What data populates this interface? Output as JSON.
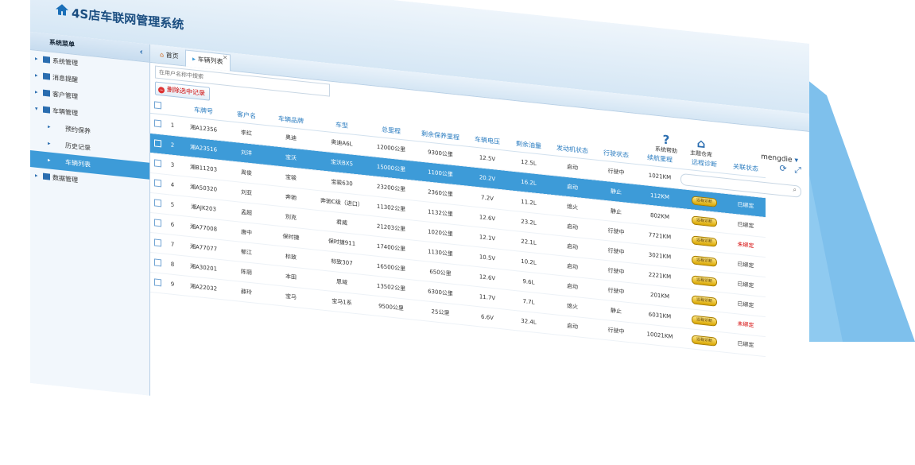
{
  "app": {
    "title": "4S店车联网管理系统"
  },
  "sidebar": {
    "header": "系统菜单",
    "collapse": "‹",
    "items": [
      {
        "label": "系统管理",
        "level": 0
      },
      {
        "label": "消息提醒",
        "level": 0
      },
      {
        "label": "客户管理",
        "level": 0
      },
      {
        "label": "车辆管理",
        "level": 0
      },
      {
        "label": "预约保养",
        "level": 1
      },
      {
        "label": "历史记录",
        "level": 1
      },
      {
        "label": "车辆列表",
        "level": 1
      },
      {
        "label": "数据管理",
        "level": 0
      }
    ]
  },
  "tabs": [
    {
      "label": "首页"
    },
    {
      "label": "车辆列表"
    }
  ],
  "toolbar": {
    "help_label": "系统帮助",
    "home_label": "主题仓库",
    "user": "mengdie",
    "search_placeholder": "在用户名称中搜索",
    "delete_label": "删除选中记录"
  },
  "table": {
    "columns": [
      "车牌号",
      "客户名",
      "车辆品牌",
      "车型",
      "总里程",
      "剩余保养里程",
      "车辆电压",
      "剩余油量",
      "发动机状态",
      "行驶状态",
      "续航里程",
      "远程诊断",
      "关联状态"
    ],
    "diag_label": "远程诊断",
    "selected_index": 1,
    "rows": [
      [
        "1",
        "湘A12356",
        "李红",
        "奥迪",
        "奥迪A6L",
        "12000公里",
        "9300公里",
        "12.5V",
        "12.5L",
        "启动",
        "行驶中",
        "1021KM",
        "已绑定"
      ],
      [
        "2",
        "湘A23516",
        "刘洋",
        "宝沃",
        "宝沃BX5",
        "15000公里",
        "1100公里",
        "20.2V",
        "16.2L",
        "启动",
        "静止",
        "112KM",
        "已绑定"
      ],
      [
        "3",
        "湘B11203",
        "周俊",
        "宝骏",
        "宝骏630",
        "23200公里",
        "2360公里",
        "7.2V",
        "11.2L",
        "熄火",
        "静止",
        "802KM",
        "已绑定"
      ],
      [
        "4",
        "湘A50320",
        "刘亚",
        "奔驰",
        "奔驰C级（进口）",
        "11302公里",
        "1132公里",
        "12.6V",
        "23.2L",
        "启动",
        "行驶中",
        "7721KM",
        "未绑定"
      ],
      [
        "5",
        "湘AJK203",
        "孟超",
        "別克",
        "君威",
        "21203公里",
        "1020公里",
        "12.1V",
        "22.1L",
        "启动",
        "行驶中",
        "3021KM",
        "已绑定"
      ],
      [
        "6",
        "湘A77008",
        "唐中",
        "保时捷",
        "保时捷911",
        "17400公里",
        "1130公里",
        "10.5V",
        "10.2L",
        "启动",
        "行驶中",
        "2221KM",
        "已绑定"
      ],
      [
        "7",
        "湘A77077",
        "郁江",
        "标致",
        "标致307",
        "16500公里",
        "650公里",
        "12.6V",
        "9.6L",
        "启动",
        "行驶中",
        "201KM",
        "已绑定"
      ],
      [
        "8",
        "湘A30201",
        "陈丽",
        "本田",
        "思域",
        "13502公里",
        "6300公里",
        "11.7V",
        "7.7L",
        "熄火",
        "静止",
        "6031KM",
        "未绑定"
      ],
      [
        "9",
        "湘A22032",
        "薛玲",
        "宝马",
        "宝马1系",
        "9500公里",
        "25公里",
        "6.6V",
        "32.4L",
        "启动",
        "行驶中",
        "10021KM",
        "已绑定"
      ]
    ]
  },
  "colors": {
    "accent": "#3d9bd8",
    "header_text": "#1a4d80",
    "unbound": "#d40000",
    "wedge": "#8cc7ef"
  }
}
